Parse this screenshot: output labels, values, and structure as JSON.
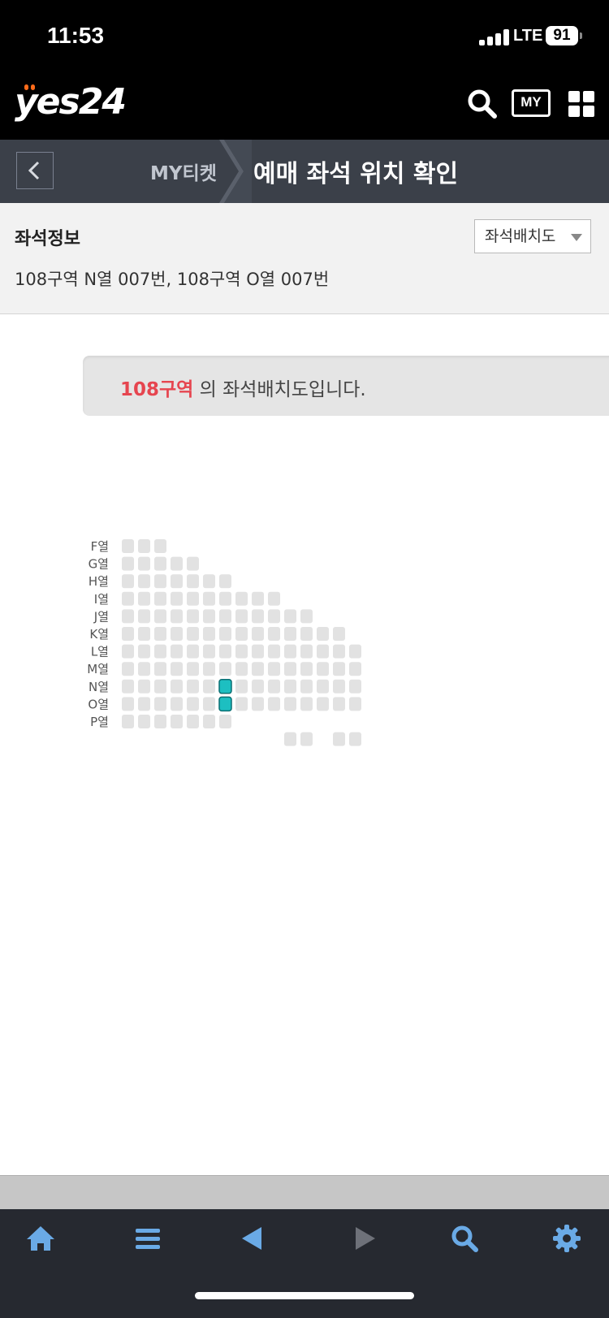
{
  "status_bar": {
    "time": "11:53",
    "network": "LTE",
    "battery": "91"
  },
  "header": {
    "logo": "yes24",
    "icons": [
      "search-icon",
      "my-ticket-icon",
      "grid-menu-icon"
    ],
    "my_label": "MY"
  },
  "navbar": {
    "parent": "MY티켓",
    "title": "예매 좌석 위치 확인"
  },
  "seat_info": {
    "title": "좌석정보",
    "detail": "108구역 N열 007번, 108구역 O열 007번",
    "map_button": "좌석배치도"
  },
  "banner": {
    "zone": "108구역",
    "suffix": " 의 좌석배치도입니다."
  },
  "seatmap": {
    "rows": [
      {
        "label": "F열",
        "seats": 3
      },
      {
        "label": "G열",
        "seats": 5
      },
      {
        "label": "H열",
        "seats": 7
      },
      {
        "label": "I열",
        "seats": 10
      },
      {
        "label": "J열",
        "seats": 12
      },
      {
        "label": "K열",
        "seats": 14
      },
      {
        "label": "L열",
        "seats": 15
      },
      {
        "label": "M열",
        "seats": 15
      },
      {
        "label": "N열",
        "seats": 15
      },
      {
        "label": "O열",
        "seats": 15
      },
      {
        "label": "P열",
        "seats": 7
      }
    ],
    "selected": [
      {
        "row": "N열",
        "seat": 7
      },
      {
        "row": "O열",
        "seat": 7
      }
    ],
    "seat_color": "#e2e2e2",
    "selected_color": "#1dbfc1"
  },
  "toolbar": {
    "icons": [
      "home-icon",
      "menu-icon",
      "back-arrow-icon",
      "forward-arrow-icon",
      "search-icon",
      "settings-icon"
    ]
  }
}
